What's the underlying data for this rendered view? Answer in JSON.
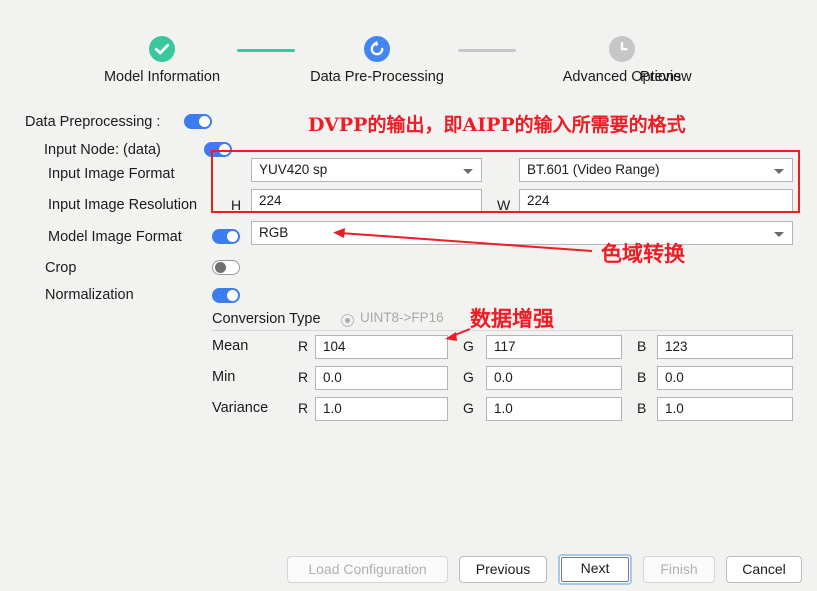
{
  "stepper": {
    "steps": [
      {
        "label": "Model Information",
        "state": "done",
        "icon": "check-circle-icon"
      },
      {
        "label": "Data Pre-Processing",
        "state": "active",
        "icon": "refresh-circle-icon"
      },
      {
        "label": "Advanced Options",
        "state": "idle",
        "icon": "clock-circle-icon"
      },
      {
        "label": "Preview",
        "state": "idle",
        "icon": ""
      }
    ]
  },
  "form": {
    "data_preprocessing_label": "Data Preprocessing  :",
    "data_preprocessing_toggle": "on",
    "input_node_label": "Input Node:   (data)",
    "input_node_toggle": "on",
    "input_image_format_label": "Input Image Format",
    "input_image_format_value": "YUV420 sp",
    "color_space_value": "BT.601 (Video Range)",
    "input_image_resolution_label": "Input Image Resolution",
    "h_label": "H",
    "h_value": "224",
    "w_label": "W",
    "w_value": "224",
    "model_image_format_label": "Model Image Format",
    "model_image_format_toggle": "on",
    "model_image_format_value": "RGB",
    "crop_label": "Crop",
    "crop_toggle": "off",
    "normalization_label": "Normalization",
    "normalization_toggle": "on",
    "conversion_type_label": "Conversion Type",
    "conversion_type_option": "UINT8->FP16",
    "channels": {
      "r": "R",
      "g": "G",
      "b": "B"
    },
    "rows": [
      {
        "label": "Mean",
        "r": "104",
        "g": "117",
        "b": "123"
      },
      {
        "label": "Min",
        "r": "0.0",
        "g": "0.0",
        "b": "0.0"
      },
      {
        "label": "Variance",
        "r": "1.0",
        "g": "1.0",
        "b": "1.0"
      }
    ]
  },
  "annotations": {
    "top": "DVPP的输出，即AIPP的输入所需要的格式",
    "color_conversion": "色域转换",
    "data_augmentation": "数据增强"
  },
  "footer": {
    "load_configuration": "Load Configuration",
    "previous": "Previous",
    "next": "Next",
    "finish": "Finish",
    "cancel": "Cancel"
  },
  "colors": {
    "accent_blue": "#3b7ded",
    "step_done_green": "#38c89d",
    "step_active_blue": "#4285f4",
    "step_idle_grey": "#c6c6c6",
    "annotation_red": "#ee1c25",
    "background": "#f2f2f0"
  }
}
